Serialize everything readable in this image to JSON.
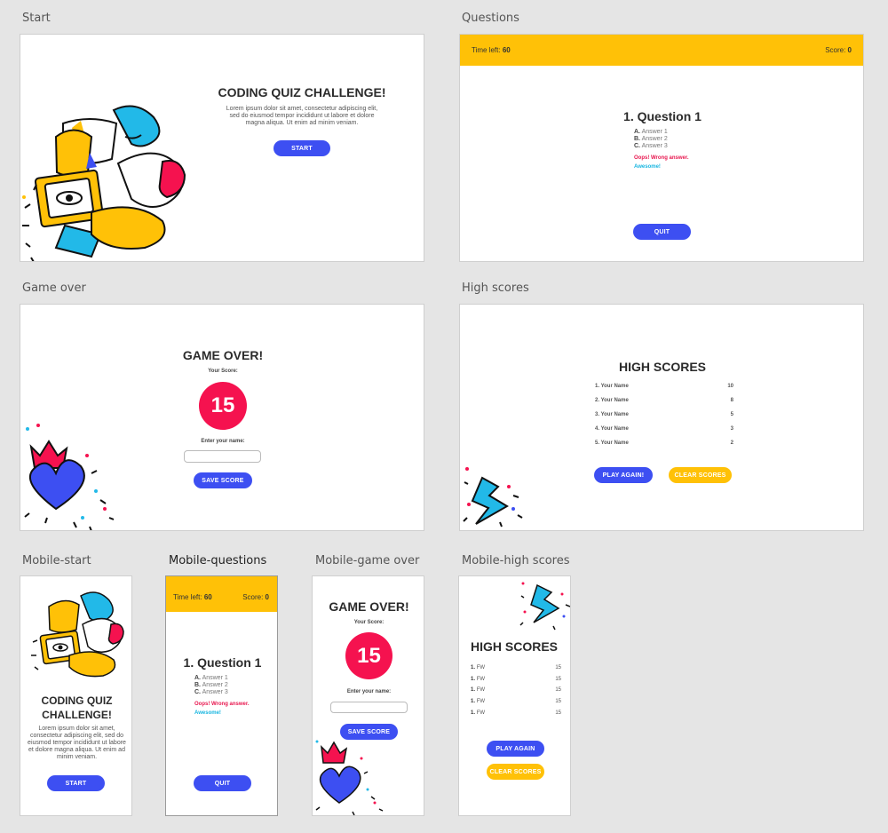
{
  "labels": {
    "start": "Start",
    "questions": "Questions",
    "game_over": "Game over",
    "high_scores": "High scores",
    "m_start": "Mobile-start",
    "m_questions": "Mobile-questions",
    "m_game_over": "Mobile-game over",
    "m_high_scores": "Mobile-high scores"
  },
  "start": {
    "title": "CODING QUIZ CHALLENGE!",
    "m_title": "CODING QUIZ CHALLENGE!",
    "lorem": "Lorem ipsum dolor sit amet, consectetur adipiscing elit, sed do eiusmod tempor incididunt ut labore et dolore magna aliqua. Ut enim ad minim veniam.",
    "button": "START"
  },
  "questions": {
    "time_label": "Time left: ",
    "time_value": "60",
    "score_label": "Score: ",
    "score_value": "0",
    "question": "1. Question 1",
    "answers": [
      {
        "letter": "A.",
        "text": "Answer 1"
      },
      {
        "letter": "B.",
        "text": "Answer 2"
      },
      {
        "letter": "C.",
        "text": "Answer 3"
      }
    ],
    "wrong": "Oops! Wrong answer.",
    "right": "Awesome!",
    "button": "QUIT"
  },
  "game_over": {
    "title": "GAME OVER!",
    "your_score": "Your Score:",
    "score": "15",
    "enter_name": "Enter your name:",
    "name_value": "",
    "button": "SAVE SCORE"
  },
  "high_scores": {
    "title": "HIGH SCORES",
    "rows": [
      {
        "name": "1. Your Name",
        "score": "10"
      },
      {
        "name": "2. Your Name",
        "score": "8"
      },
      {
        "name": "3. Your Name",
        "score": "5"
      },
      {
        "name": "4. Your Name",
        "score": "3"
      },
      {
        "name": "5. Your Name",
        "score": "2"
      }
    ],
    "play_again": "PLAY AGAIN!",
    "clear": "CLEAR SCORES",
    "m_rows": [
      {
        "num": "1.",
        "name": "FW",
        "score": "15"
      },
      {
        "num": "1.",
        "name": "FW",
        "score": "15"
      },
      {
        "num": "1.",
        "name": "FW",
        "score": "15"
      },
      {
        "num": "1.",
        "name": "FW",
        "score": "15"
      },
      {
        "num": "1.",
        "name": "FW",
        "score": "15"
      }
    ],
    "m_play_again": "PLAY AGAIN"
  },
  "colors": {
    "blue": "#3d4ff2",
    "yellow": "#ffc107",
    "red": "#f5124f",
    "cyan": "#18b6e0"
  }
}
